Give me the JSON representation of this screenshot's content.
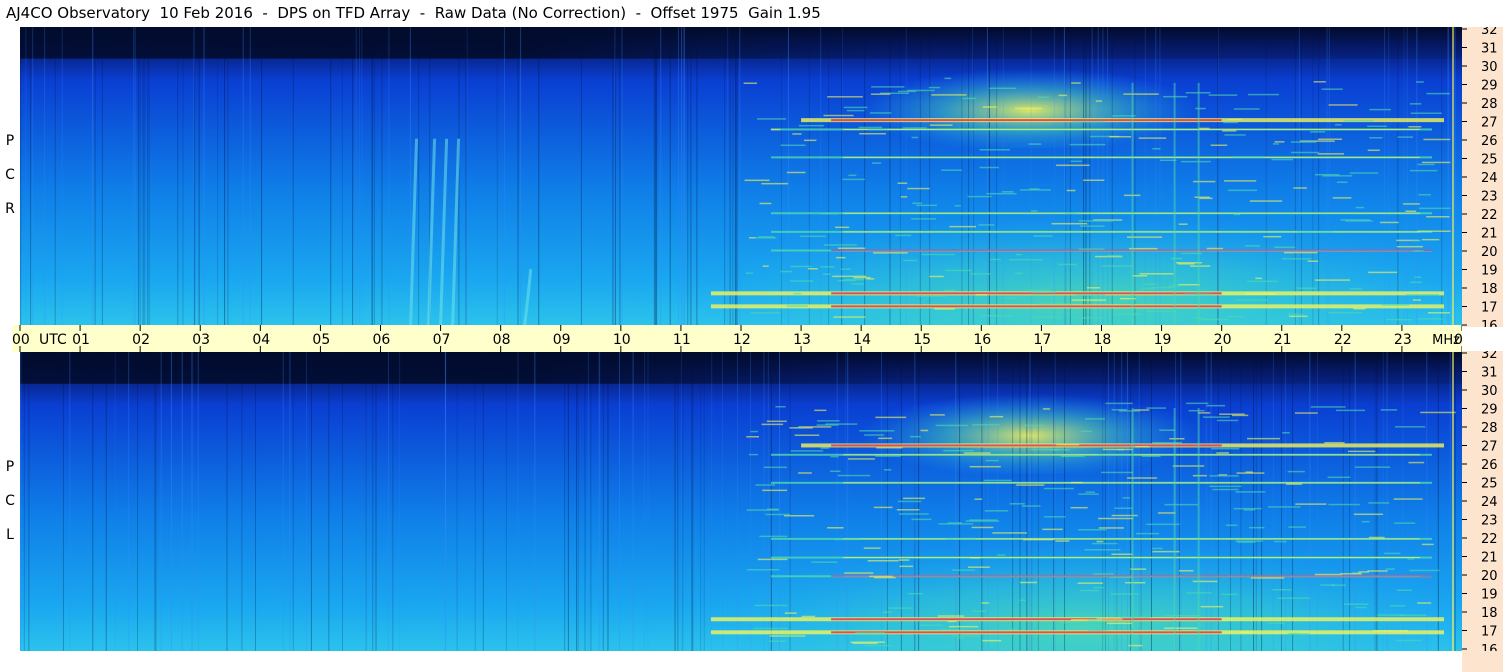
{
  "title": "AJ4CO Observatory  10 Feb 2016  -  DPS on TFD Array  -  Raw Data (No Correction)  -  Offset 1975  Gain 1.95",
  "panels": [
    {
      "id": "top",
      "letters": [
        "R",
        "C",
        "P"
      ]
    },
    {
      "id": "bottom",
      "letters": [
        "L",
        "C",
        "P"
      ]
    }
  ],
  "colors": {
    "dark": "#020b2a",
    "blue": "#0a3fd2",
    "cyan": "#1aa7f0",
    "green": "#4fd9b0",
    "yellow": "#f5f55a",
    "red": "#e0305f",
    "time_axis_bg": "#ffffcc",
    "freq_axis_bg": "#fce4cf"
  },
  "chart_data": {
    "type": "heatmap",
    "x_axis": {
      "tick_labels": [
        "00",
        "01",
        "02",
        "03",
        "04",
        "05",
        "06",
        "07",
        "08",
        "09",
        "10",
        "11",
        "12",
        "13",
        "14",
        "15",
        "16",
        "17",
        "18",
        "19",
        "20",
        "21",
        "22",
        "23",
        "00"
      ],
      "unit_label": "UTC",
      "range_hours": [
        0,
        24
      ]
    },
    "y_axis": {
      "tick_labels": [
        "16",
        "17",
        "18",
        "19",
        "20",
        "21",
        "22",
        "23",
        "24",
        "25",
        "26",
        "27",
        "28",
        "29",
        "30",
        "31",
        "32"
      ],
      "unit_label": "MHz",
      "range_mhz": [
        16,
        32
      ]
    },
    "features": {
      "strong_bands_mhz": [
        17,
        17.7,
        27
      ],
      "moderate_bands_mhz": [
        20,
        21,
        22,
        25,
        26.5
      ],
      "emission_bursts_utc": [
        6.6,
        6.9,
        7.1,
        7.3,
        8.5
      ],
      "bright_region_utc": [
        12,
        23.5
      ],
      "hot_spot_utc_center": 16.8,
      "vertical_rfi_utc": [
        18.5,
        19.2,
        19.6
      ]
    }
  }
}
